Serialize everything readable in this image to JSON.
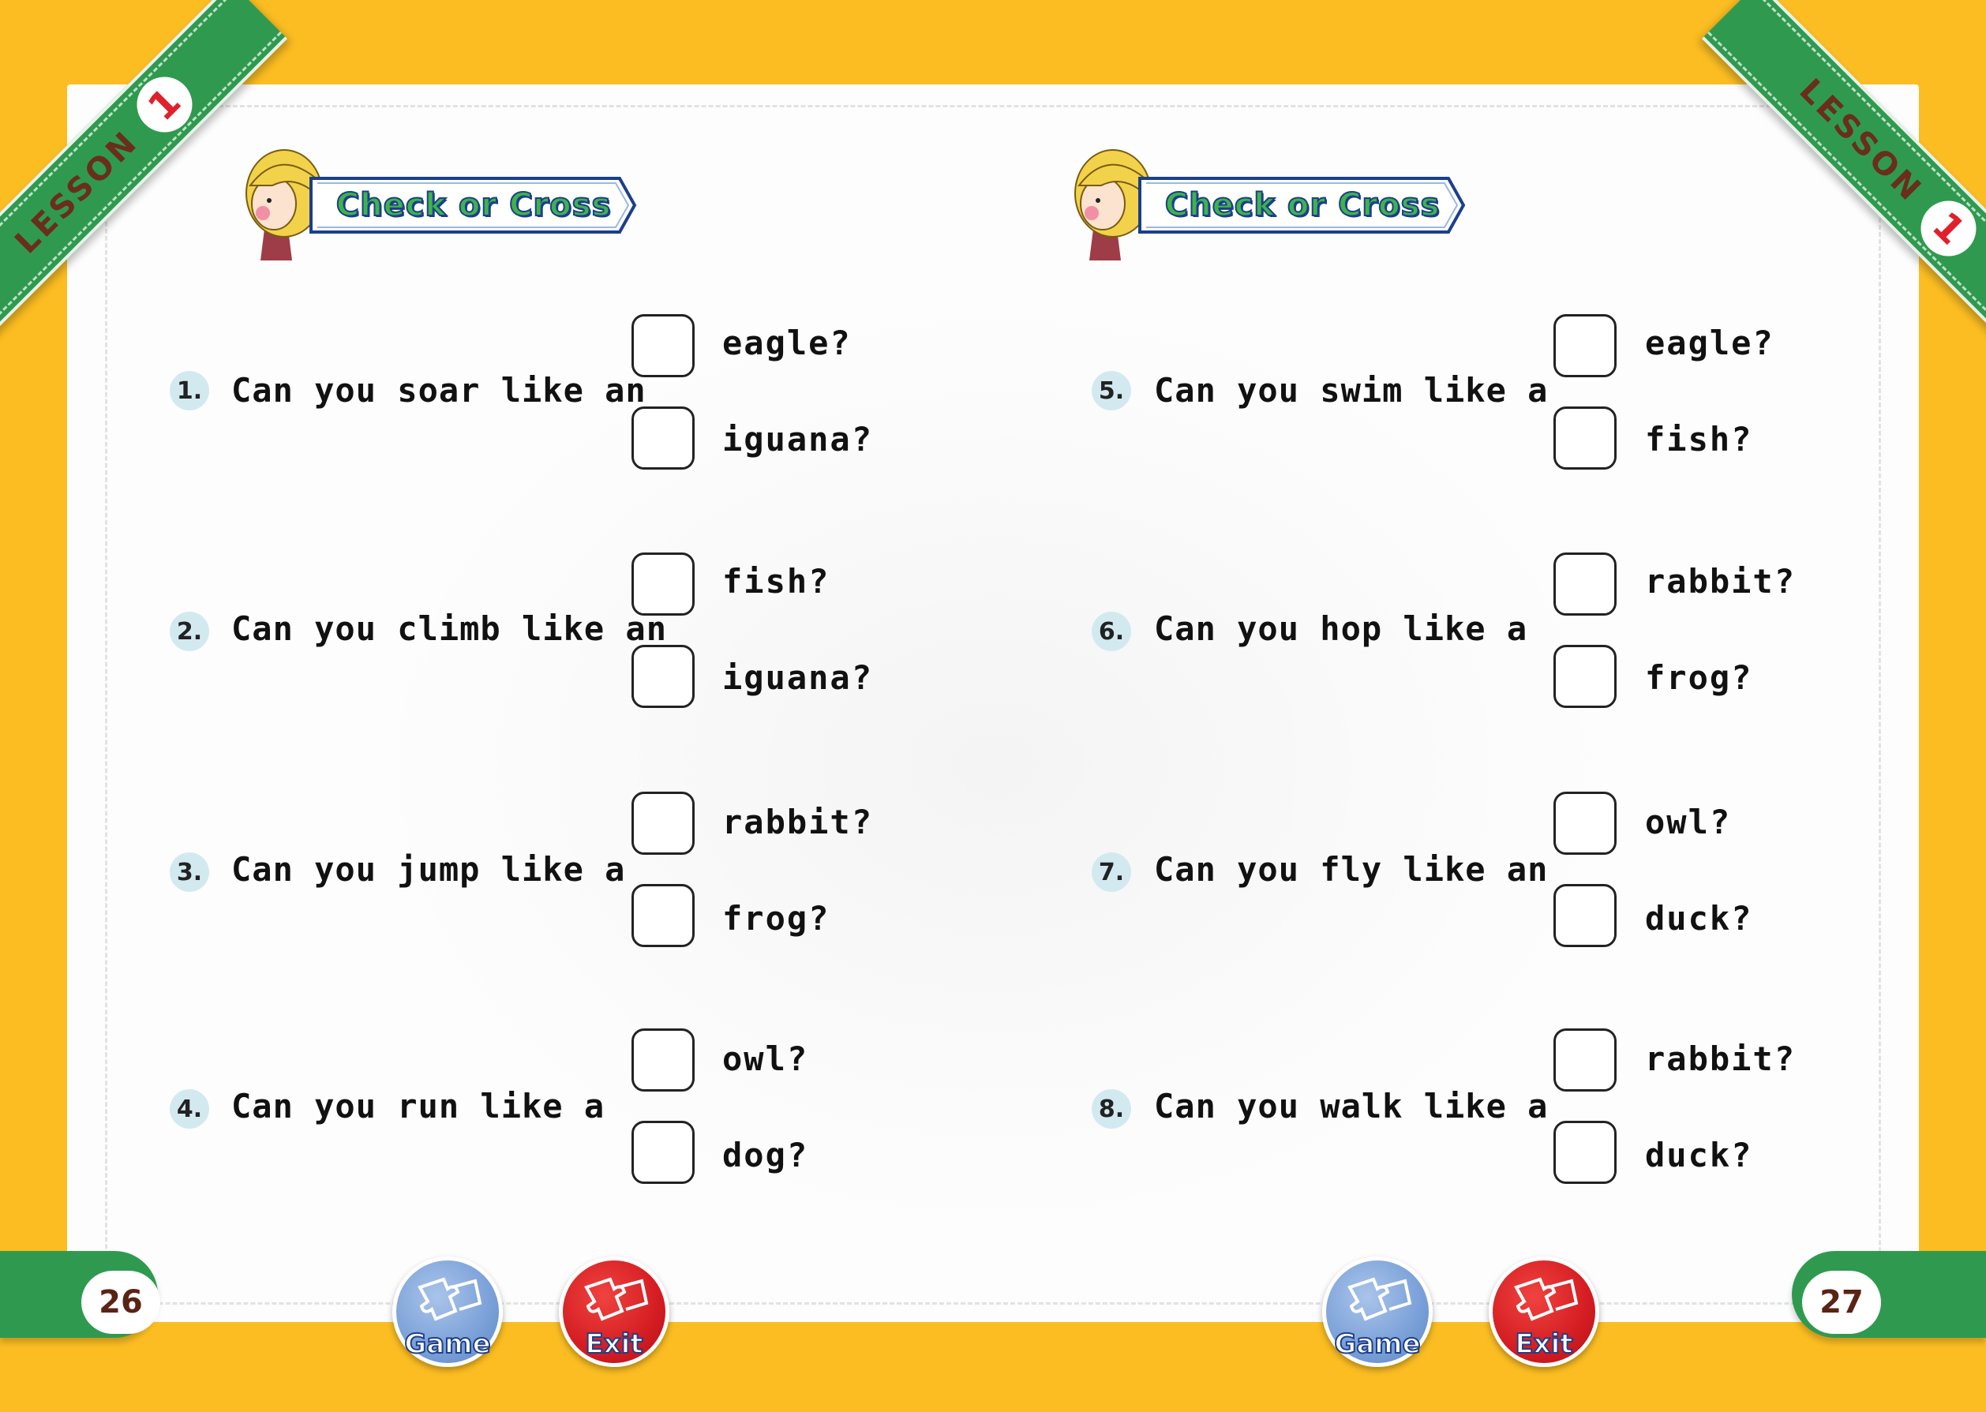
{
  "lesson": {
    "word": "LESSON",
    "number": "1"
  },
  "section_title": "Check or Cross",
  "questions_left": [
    {
      "num": "1.",
      "text": "Can you soar like an",
      "opt1": "eagle?",
      "opt2": "iguana?"
    },
    {
      "num": "2.",
      "text": "Can you climb like an",
      "opt1": "fish?",
      "opt2": "iguana?"
    },
    {
      "num": "3.",
      "text": "Can you jump like a",
      "opt1": "rabbit?",
      "opt2": "frog?"
    },
    {
      "num": "4.",
      "text": "Can you run like a",
      "opt1": "owl?",
      "opt2": "dog?"
    }
  ],
  "questions_right": [
    {
      "num": "5.",
      "text": "Can you swim like a",
      "opt1": "eagle?",
      "opt2": "fish?"
    },
    {
      "num": "6.",
      "text": "Can you hop like a",
      "opt1": "rabbit?",
      "opt2": "frog?"
    },
    {
      "num": "7.",
      "text": "Can you fly like an",
      "opt1": "owl?",
      "opt2": "duck?"
    },
    {
      "num": "8.",
      "text": "Can you walk like a",
      "opt1": "rabbit?",
      "opt2": "duck?"
    }
  ],
  "pages": {
    "left": "26",
    "right": "27"
  },
  "buttons": {
    "game": "Game",
    "exit": "Exit"
  },
  "colors": {
    "background": "#fbbd22",
    "ribbon": "#2f9a4f",
    "lesson_number": "#e0202a"
  }
}
